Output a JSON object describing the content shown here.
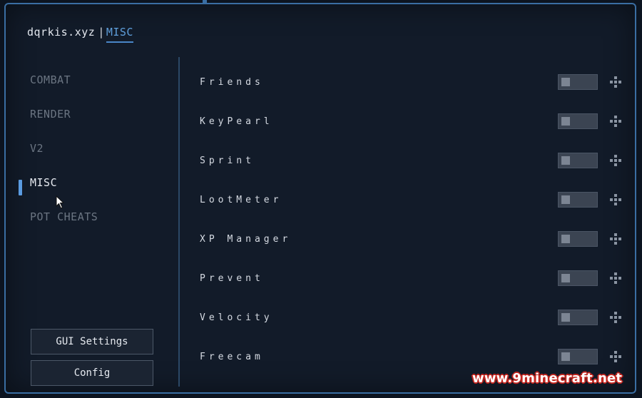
{
  "window": {
    "client_name": "dqrkis.xyz",
    "separator": "|",
    "active_category": "MISC"
  },
  "sidebar": {
    "categories": [
      {
        "label": "COMBAT",
        "selected": false
      },
      {
        "label": "RENDER",
        "selected": false
      },
      {
        "label": "V2",
        "selected": false
      },
      {
        "label": "MISC",
        "selected": true
      },
      {
        "label": "POT CHEATS",
        "selected": false
      }
    ],
    "gui_settings_label": "GUI Settings",
    "config_label": "Config"
  },
  "modules": [
    {
      "label": "Friends",
      "enabled": false
    },
    {
      "label": "KeyPearl",
      "enabled": false
    },
    {
      "label": "Sprint",
      "enabled": false
    },
    {
      "label": "LootMeter",
      "enabled": false
    },
    {
      "label": "XP Manager",
      "enabled": false
    },
    {
      "label": "Prevent",
      "enabled": false
    },
    {
      "label": "Velocity",
      "enabled": false
    },
    {
      "label": "Freecam",
      "enabled": false
    }
  ],
  "watermark": "www.9minecraft.net",
  "colors": {
    "accent": "#5a9be0",
    "frame_border": "#3a6ea3",
    "background": "#121b29",
    "toggle_off": "#3b4452",
    "watermark_outline": "#c0251f"
  }
}
